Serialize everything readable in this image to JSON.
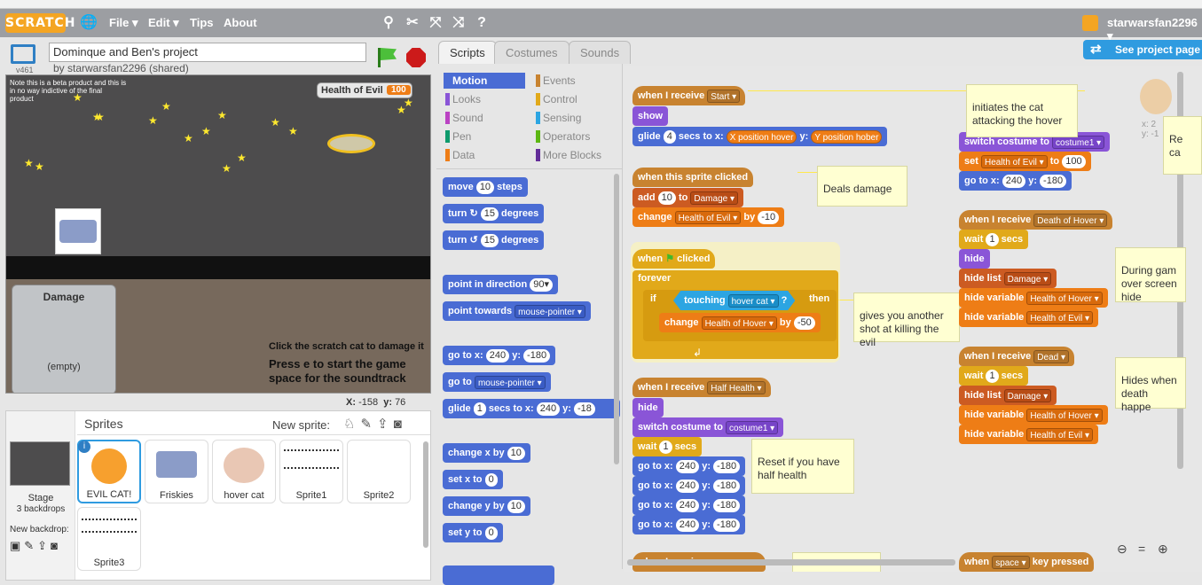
{
  "menubar": {
    "logo": "SCRATCH",
    "file": "File ▾",
    "edit": "Edit ▾",
    "tips": "Tips",
    "about": "About",
    "user": "starwarsfan2296 ▾"
  },
  "project": {
    "title": "Dominque and Ben's project",
    "by": "by starwarsfan2296 (shared)",
    "version": "v461"
  },
  "stage": {
    "note": "Note this is a beta product and this is in no way indictive of the final product",
    "var_label": "Health of Evil",
    "var_value": "100",
    "list_title": "Damage",
    "list_empty": "(empty)",
    "hint1": "Click the scratch cat to damage it",
    "hint2": "Press e to start the game",
    "hint3": "space for the soundtrack",
    "coord_x_label": "X:",
    "coord_x": "-158",
    "coord_y_label": "y:",
    "coord_y": "76"
  },
  "tabs": {
    "scripts": "Scripts",
    "costumes": "Costumes",
    "sounds": "Sounds"
  },
  "see_project": "See project page",
  "categories": {
    "left": [
      "Motion",
      "Looks",
      "Sound",
      "Pen",
      "Data"
    ],
    "right": [
      "Events",
      "Control",
      "Sensing",
      "Operators",
      "More Blocks"
    ]
  },
  "category_colors": {
    "Motion": "#4a6cd4",
    "Looks": "#8a55d7",
    "Sound": "#bb42c3",
    "Pen": "#0e9a6c",
    "Data": "#ee7d16",
    "Events": "#c88330",
    "Control": "#e1a91a",
    "Sensing": "#2ca5e2",
    "Operators": "#5cb712",
    "More Blocks": "#632d99"
  },
  "palette": {
    "move": "move",
    "move_val": "10",
    "steps": "steps",
    "turn": "turn",
    "turn_val": "15",
    "degrees": "degrees",
    "point_dir": "point in direction",
    "dir_val": "90▾",
    "point_towards": "point towards",
    "towards_val": "mouse-pointer ▾",
    "goto": "go to x:",
    "gx": "240",
    "gy_label": "y:",
    "gy": "-180",
    "goto2": "go to",
    "goto2_val": "mouse-pointer ▾",
    "glide": "glide",
    "glide_val": "1",
    "glide_secs": "secs to x:",
    "glide_x": "240",
    "glide_y_label": "y:",
    "glide_y": "-18",
    "change_x": "change x by",
    "cx": "10",
    "set_x": "set x to",
    "sx": "0",
    "change_y": "change y by",
    "cy": "10",
    "set_y": "set y to",
    "sy": "0"
  },
  "scripts": {
    "when_receive": "when I receive",
    "start": "Start ▾",
    "show": "show",
    "glide": "glide",
    "glide_secs": "4",
    "secs_to_x": "secs to x:",
    "x_pos_hover": "X position hover",
    "y_label": "y:",
    "y_pos_hover": "Y position hober",
    "when_clicked": "when this sprite clicked",
    "add": "add",
    "add_val": "10",
    "to": "to",
    "damage_dd": "Damage ▾",
    "change": "change",
    "health_evil_dd": "Health of Evil ▾",
    "by": "by",
    "by_val": "-10",
    "note_deals": "Deals damage",
    "when_flag": "when",
    "clicked": "clicked",
    "forever": "forever",
    "if": "if",
    "touching": "touching",
    "hover_cat_dd": "hover cat ▾",
    "q": "?",
    "then": "then",
    "change_hover": "Health of Hover ▾",
    "by_val2": "-50",
    "note_gives": "gives you another shot at killing the evil",
    "half_health_dd": "Half Health ▾",
    "hide": "hide",
    "switch_costume": "switch costume to",
    "costume1_dd": "costume1 ▾",
    "wait": "wait",
    "wait_val": "1",
    "secs": "secs",
    "goto": "go to x:",
    "gx": "240",
    "gy": "-180",
    "note_reset": "Reset if you have half health",
    "note_initiates": "initiates the cat attacking the hover",
    "set": "set",
    "set_val": "100",
    "death_hover_dd": "Death of Hover ▾",
    "hide_list": "hide list",
    "hide_variable": "hide variable",
    "health_hover_dd": "Health of Hover ▾",
    "note_during": "During gam over screen hide",
    "dead_dd": "Dead ▾",
    "note_hides": "Hides when death happe",
    "when_key": "when",
    "space_dd": "space ▾",
    "key_pressed": "key pressed",
    "re_ca": "Re ca",
    "coords": "x: 2  y: -1"
  },
  "sprites": {
    "title": "Sprites",
    "new_sprite": "New sprite:",
    "stage_label": "Stage",
    "backdrops": "3 backdrops",
    "new_backdrop": "New backdrop:",
    "list": [
      "EVIL CAT!",
      "Friskies",
      "hover cat",
      "Sprite1",
      "Sprite2",
      "Sprite3"
    ]
  }
}
